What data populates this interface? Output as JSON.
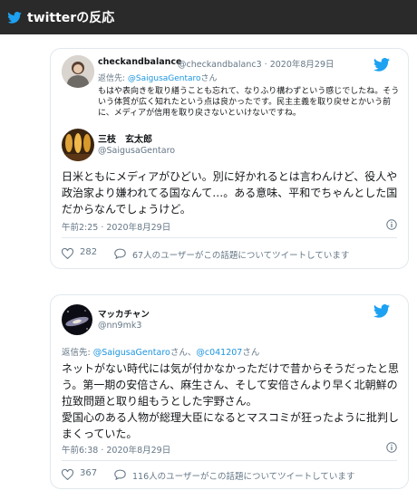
{
  "header": {
    "title": "twitterの反応"
  },
  "colors": {
    "header_bg": "#2a2a2a",
    "twitter_blue": "#1da1f2",
    "link_blue": "#1b95e0",
    "muted": "#657786"
  },
  "tweets": [
    {
      "quoted": {
        "name": "checkandbalance",
        "handle": "@checkandbalanc3",
        "date": "· 2020年8月29日",
        "reply_label": "返信先:",
        "reply_to": "@SaigusaGentaro",
        "reply_suffix": "さん",
        "text": "もはや表向きを取り繕うことも忘れて、なりふり構わずという感じでしたね。そういう体質が広く知れたという点は良かったです。民主主義を取り戻せとかいう前に、メディアが信用を取り戻さないといけないですね。"
      },
      "author": {
        "name": "三枝　玄太郎",
        "handle": "@SaigusaGentaro"
      },
      "text": "日米ともにメディアがひどい。別に好かれるとは言わんけど、役人や政治家より嫌われてる国なんて…。ある意味、平和でちゃんとした国だからなんでしょうけど。",
      "timestamp": "午前2:25 · 2020年8月29日",
      "likes": "282",
      "discussion": "67人のユーザーがこの話題についてツイートしています"
    },
    {
      "author": {
        "name": "マッカチャン",
        "handle": "@nn9mk3"
      },
      "reply_label": "返信先:",
      "reply_to": "@SaigusaGentaro",
      "reply_sep": "さん、",
      "reply_to2": "@c041207",
      "reply_suffix": "さん",
      "text": "ネットがない時代には気が付かなかっただけで昔からそうだったと思う。第一期の安倍さん、麻生さん、そして安倍さんより早く北朝鮮の拉致問題と取り組もうとした宇野さん。\n愛国心のある人物が総理大臣になるとマスコミが狂ったように批判しまくっていた。",
      "timestamp": "午前6:38 · 2020年8月29日",
      "likes": "367",
      "discussion": "116人のユーザーがこの話題についてツイートしています"
    }
  ]
}
